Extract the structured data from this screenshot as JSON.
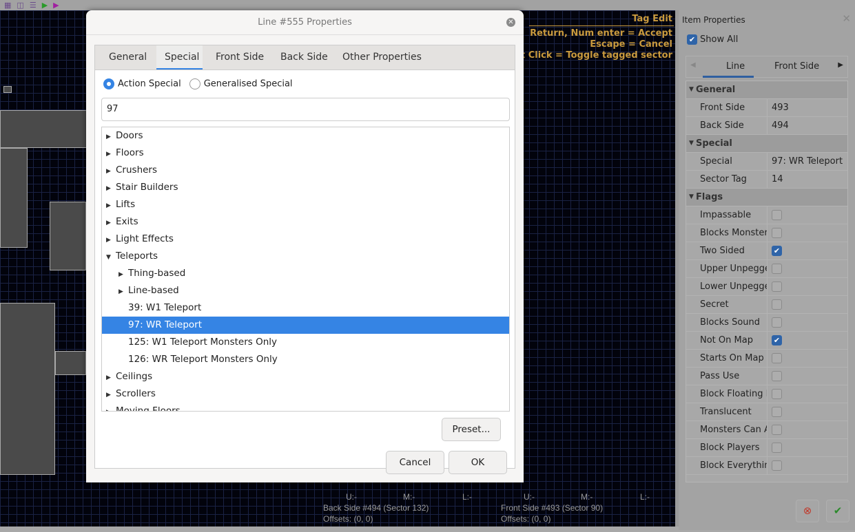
{
  "toolbar": {
    "icons": [
      "grid-icon",
      "split-icon",
      "align-icon",
      "play-icon",
      "play-special-icon"
    ]
  },
  "map": {
    "hints": {
      "title": "Tag Edit",
      "accept": "Return, Num enter = Accept",
      "cancel": "Escape = Cancel",
      "toggle": "Left Click = Toggle tagged sector"
    },
    "status": {
      "back_u": "U:-",
      "back_m": "M:-",
      "back_l": "L:-",
      "front_u": "U:-",
      "front_m": "M:-",
      "front_l": "L:-",
      "back_side": "Back Side #494 (Sector 132)",
      "back_offsets": "Offsets: (0, 0)",
      "front_side": "Front Side #493 (Sector 90)",
      "front_offsets": "Offsets: (0, 0)"
    }
  },
  "dialog": {
    "title": "Line #555 Properties",
    "tabs": [
      "General",
      "Special",
      "Front Side",
      "Back Side",
      "Other Properties"
    ],
    "active_tab": "Special",
    "radio_action": "Action Special",
    "radio_generalised": "Generalised Special",
    "selected_radio": "Action Special",
    "search_value": "97",
    "tree": [
      {
        "label": "Doors",
        "level": 0,
        "arrow": "collapsed"
      },
      {
        "label": "Floors",
        "level": 0,
        "arrow": "collapsed"
      },
      {
        "label": "Crushers",
        "level": 0,
        "arrow": "collapsed"
      },
      {
        "label": "Stair Builders",
        "level": 0,
        "arrow": "collapsed"
      },
      {
        "label": "Lifts",
        "level": 0,
        "arrow": "collapsed"
      },
      {
        "label": "Exits",
        "level": 0,
        "arrow": "collapsed"
      },
      {
        "label": "Light Effects",
        "level": 0,
        "arrow": "collapsed"
      },
      {
        "label": "Teleports",
        "level": 0,
        "arrow": "expanded"
      },
      {
        "label": "Thing-based",
        "level": 1,
        "arrow": "collapsed"
      },
      {
        "label": "Line-based",
        "level": 1,
        "arrow": "collapsed"
      },
      {
        "label": "39: W1 Teleport",
        "level": 1,
        "arrow": "none"
      },
      {
        "label": "97: WR Teleport",
        "level": 1,
        "arrow": "none",
        "selected": true
      },
      {
        "label": "125: W1 Teleport Monsters Only",
        "level": 1,
        "arrow": "none"
      },
      {
        "label": "126: WR Teleport Monsters Only",
        "level": 1,
        "arrow": "none"
      },
      {
        "label": "Ceilings",
        "level": 0,
        "arrow": "collapsed"
      },
      {
        "label": "Scrollers",
        "level": 0,
        "arrow": "collapsed"
      },
      {
        "label": "Moving Floors",
        "level": 0,
        "arrow": "collapsed"
      }
    ],
    "preset": "Preset...",
    "cancel": "Cancel",
    "ok": "OK"
  },
  "panel": {
    "title": "Item Properties",
    "show_all": "Show All",
    "tabs": [
      "Line",
      "Front Side"
    ],
    "active_tab": "Line",
    "rows": [
      {
        "group": "General"
      },
      {
        "key": "Front Side",
        "value": "493"
      },
      {
        "key": "Back Side",
        "value": "494"
      },
      {
        "group": "Special"
      },
      {
        "key": "Special",
        "value": "97: WR Teleport"
      },
      {
        "key": "Sector Tag",
        "value": "14"
      },
      {
        "group": "Flags"
      },
      {
        "key": "Impassable",
        "checked": false
      },
      {
        "key": "Blocks Monsters",
        "checked": false
      },
      {
        "key": "Two Sided",
        "checked": true
      },
      {
        "key": "Upper Unpegged",
        "checked": false
      },
      {
        "key": "Lower Unpegged",
        "checked": false
      },
      {
        "key": "Secret",
        "checked": false
      },
      {
        "key": "Blocks Sound",
        "checked": false
      },
      {
        "key": "Not On Map",
        "checked": true
      },
      {
        "key": "Starts On Map",
        "checked": false
      },
      {
        "key": "Pass Use",
        "checked": false
      },
      {
        "key": "Block Floating Monsters",
        "checked": false
      },
      {
        "key": "Translucent",
        "checked": false
      },
      {
        "key": "Monsters Can Activate",
        "checked": false
      },
      {
        "key": "Block Players",
        "checked": false
      },
      {
        "key": "Block Everything",
        "checked": false
      }
    ]
  },
  "colors": {
    "accent": "#3584e4",
    "hint_text": "#c99a3e",
    "map_bg": "#02030c"
  }
}
